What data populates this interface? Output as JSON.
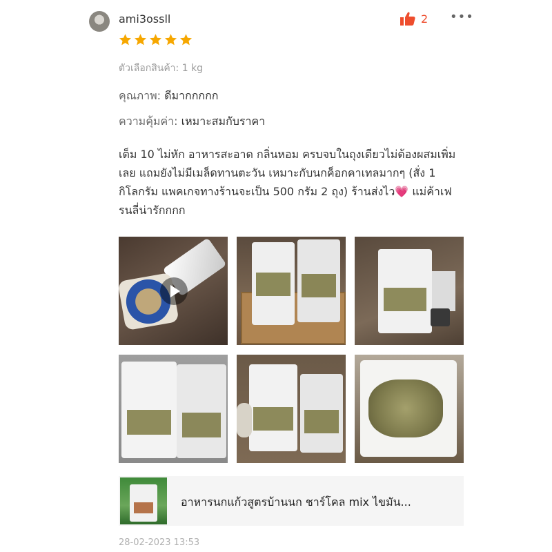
{
  "review": {
    "username": "ami3ossll",
    "like_count": "2",
    "rating": 5,
    "variant": "ตัวเลือกสินค้า: 1 kg",
    "quality_label": "คุณภาพ:",
    "quality_value": "ดีมากกกกก",
    "value_label": "ความคุ้มค่า:",
    "value_value": "เหมาะสมกับราคา",
    "body": "เต็ม 10 ไม่หัก อาหารสะอาด กลิ่นหอม ครบจบในถุงเดียวไม่ต้องผสมเพิ่มเลย แถมยังไม่มีเมล็ดทานตะวัน เหมาะกับนกค็อกคาเทลมากๆ (สั่ง 1 กิโลกรัม แพคเกจทางร้านจะเป็น 500 กรัม 2 ถุง) ร้านส่งไว",
    "body_emoji": "💗",
    "body_tail": " แม่ค้าเฟรนลี่น่ารักกกก",
    "date": "28-02-2023 13:53"
  },
  "icons": {
    "like": "thumbs-up-icon",
    "more": "more-dots-icon",
    "star": "star-icon",
    "play": "play-icon"
  },
  "colors": {
    "accent": "#ee4d2d",
    "star": "#f6a700",
    "muted": "#9b9b9b"
  },
  "product": {
    "title": "อาหารนกแก้วสูตรบ้านนก ชาร์โคล mix ไขมัน..."
  }
}
